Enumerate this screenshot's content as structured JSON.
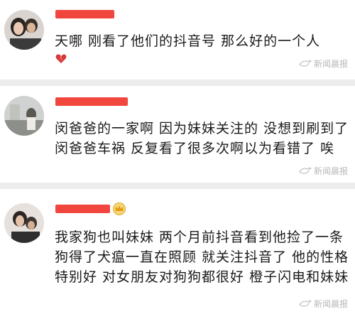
{
  "comments": [
    {
      "text": "天哪 刚看了他们的抖音号 那么好的一个人",
      "reaction_icon": "broken-heart-icon",
      "watermark": "新闻晨报"
    },
    {
      "text": "闵爸爸的一家啊 因为妹妹关注的 没想到刷到了闵爸爸车祸 反复看了很多次啊以为看错了 唉",
      "watermark": "新闻晨报"
    },
    {
      "text": "我家狗也叫妹妹 两个月前抖音看到他捡了一条狗得了犬瘟一直在照顾 就关注抖音了 他的性格特别好 对女朋友对狗狗都很好 橙子闪电和妹妹",
      "badge_icon": "crown-badge-icon",
      "watermark": "新闻晨报"
    }
  ],
  "colors": {
    "redaction": "#f0362e",
    "text": "#1a1a1a",
    "watermark": "#b8b8b8",
    "background": "#f2f2f2"
  }
}
